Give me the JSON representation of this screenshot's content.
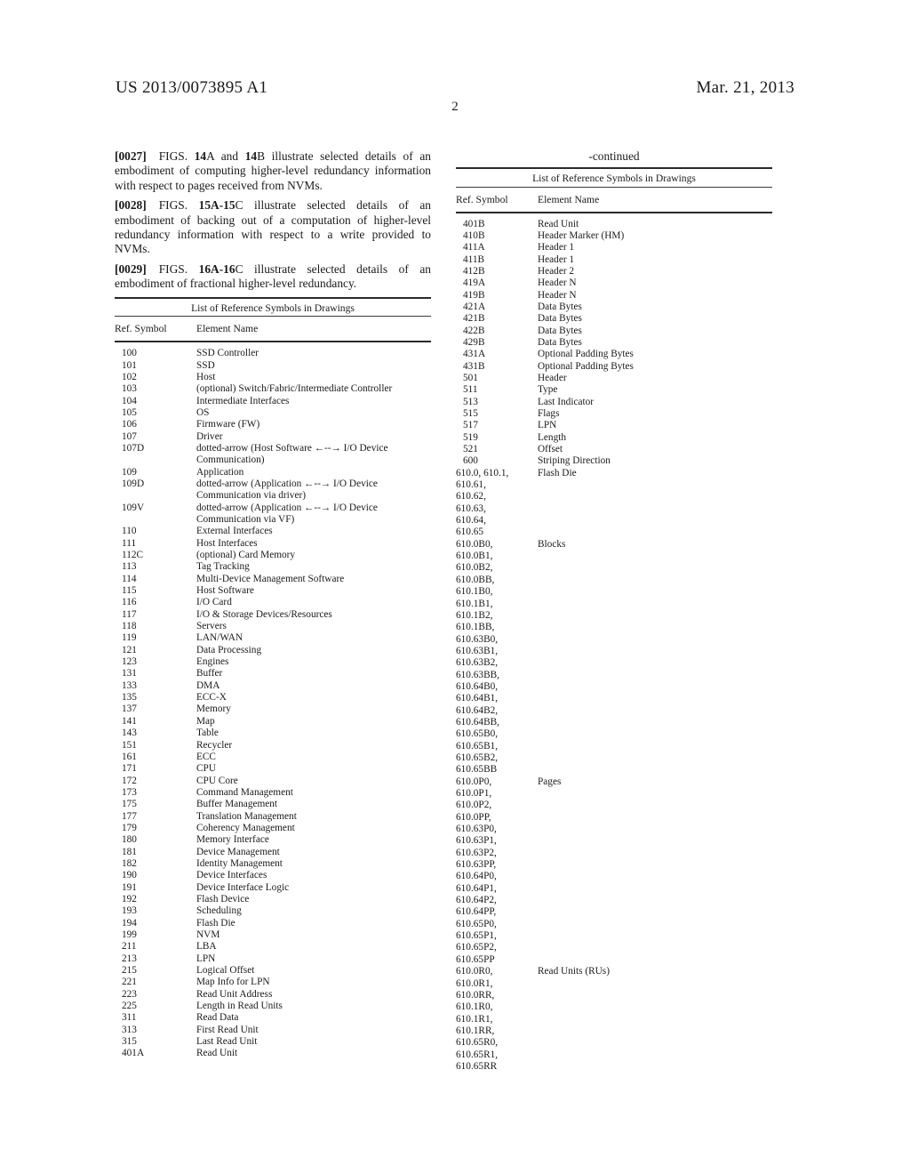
{
  "header": {
    "publication_number": "US 2013/0073895 A1",
    "date": "Mar. 21, 2013",
    "page_number": "2"
  },
  "paragraphs": [
    {
      "number": "[0027]",
      "text": "FIGS. 14A and 14B illustrate selected details of an embodiment of computing higher-level redundancy information with respect to pages received from NVMs."
    },
    {
      "number": "[0028]",
      "text": "FIGS. 15A-15C illustrate selected details of an embodiment of backing out of a computation of higher-level redundancy information with respect to a write provided to NVMs."
    },
    {
      "number": "[0029]",
      "text": "FIGS. 16A-16C illustrate selected details of an embodiment of fractional higher-level redundancy."
    }
  ],
  "left_table": {
    "caption": "List of Reference Symbols in Drawings",
    "columns": [
      "Ref. Symbol",
      "Element Name"
    ],
    "rows": [
      {
        "symbol": "100",
        "name": "SSD Controller"
      },
      {
        "symbol": "101",
        "name": "SSD"
      },
      {
        "symbol": "102",
        "name": "Host"
      },
      {
        "symbol": "103",
        "name": "(optional) Switch/Fabric/Intermediate Controller"
      },
      {
        "symbol": "104",
        "name": "Intermediate Interfaces"
      },
      {
        "symbol": "105",
        "name": "OS"
      },
      {
        "symbol": "106",
        "name": "Firmware (FW)"
      },
      {
        "symbol": "107",
        "name": "Driver"
      },
      {
        "symbol": "107D",
        "name": "dotted-arrow (Host Software ←--→ I/O Device"
      },
      {
        "symbol": "",
        "name": "Communication)"
      },
      {
        "symbol": "109",
        "name": "Application"
      },
      {
        "symbol": "109D",
        "name": "dotted-arrow (Application ←--→ I/O Device"
      },
      {
        "symbol": "",
        "name": "Communication via driver)"
      },
      {
        "symbol": "109V",
        "name": "dotted-arrow (Application ←--→ I/O Device"
      },
      {
        "symbol": "",
        "name": "Communication via VF)"
      },
      {
        "symbol": "110",
        "name": "External Interfaces"
      },
      {
        "symbol": "111",
        "name": "Host Interfaces"
      },
      {
        "symbol": "112C",
        "name": "(optional) Card Memory"
      },
      {
        "symbol": "113",
        "name": "Tag Tracking"
      },
      {
        "symbol": "114",
        "name": "Multi-Device Management Software"
      },
      {
        "symbol": "115",
        "name": "Host Software"
      },
      {
        "symbol": "116",
        "name": "I/O Card"
      },
      {
        "symbol": "117",
        "name": "I/O & Storage Devices/Resources"
      },
      {
        "symbol": "118",
        "name": "Servers"
      },
      {
        "symbol": "119",
        "name": "LAN/WAN"
      },
      {
        "symbol": "121",
        "name": "Data Processing"
      },
      {
        "symbol": "123",
        "name": "Engines"
      },
      {
        "symbol": "131",
        "name": "Buffer"
      },
      {
        "symbol": "133",
        "name": "DMA"
      },
      {
        "symbol": "135",
        "name": "ECC-X"
      },
      {
        "symbol": "137",
        "name": "Memory"
      },
      {
        "symbol": "141",
        "name": "Map"
      },
      {
        "symbol": "143",
        "name": "Table"
      },
      {
        "symbol": "151",
        "name": "Recycler"
      },
      {
        "symbol": "161",
        "name": "ECC"
      },
      {
        "symbol": "171",
        "name": "CPU"
      },
      {
        "symbol": "172",
        "name": "CPU Core"
      },
      {
        "symbol": "173",
        "name": "Command Management"
      },
      {
        "symbol": "175",
        "name": "Buffer Management"
      },
      {
        "symbol": "177",
        "name": "Translation Management"
      },
      {
        "symbol": "179",
        "name": "Coherency Management"
      },
      {
        "symbol": "180",
        "name": "Memory Interface"
      },
      {
        "symbol": "181",
        "name": "Device Management"
      },
      {
        "symbol": "182",
        "name": "Identity Management"
      },
      {
        "symbol": "190",
        "name": "Device Interfaces"
      },
      {
        "symbol": "191",
        "name": "Device Interface Logic"
      },
      {
        "symbol": "192",
        "name": "Flash Device"
      },
      {
        "symbol": "193",
        "name": "Scheduling"
      },
      {
        "symbol": "194",
        "name": "Flash Die"
      },
      {
        "symbol": "199",
        "name": "NVM"
      },
      {
        "symbol": "211",
        "name": "LBA"
      },
      {
        "symbol": "213",
        "name": "LPN"
      },
      {
        "symbol": "215",
        "name": "Logical Offset"
      },
      {
        "symbol": "221",
        "name": "Map Info for LPN"
      },
      {
        "symbol": "223",
        "name": "Read Unit Address"
      },
      {
        "symbol": "225",
        "name": "Length in Read Units"
      },
      {
        "symbol": "311",
        "name": "Read Data"
      },
      {
        "symbol": "313",
        "name": "First Read Unit"
      },
      {
        "symbol": "315",
        "name": "Last Read Unit"
      },
      {
        "symbol": "401A",
        "name": "Read Unit"
      }
    ]
  },
  "right_table": {
    "continued_label": "-continued",
    "caption": "List of Reference Symbols in Drawings",
    "columns": [
      "Ref. Symbol",
      "Element Name"
    ],
    "rows": [
      {
        "symbol": "401B",
        "name": "Read Unit"
      },
      {
        "symbol": "410B",
        "name": "Header Marker (HM)"
      },
      {
        "symbol": "411A",
        "name": "Header 1"
      },
      {
        "symbol": "411B",
        "name": "Header 1"
      },
      {
        "symbol": "412B",
        "name": "Header 2"
      },
      {
        "symbol": "419A",
        "name": "Header N"
      },
      {
        "symbol": "419B",
        "name": "Header N"
      },
      {
        "symbol": "421A",
        "name": "Data Bytes"
      },
      {
        "symbol": "421B",
        "name": "Data Bytes"
      },
      {
        "symbol": "422B",
        "name": "Data Bytes"
      },
      {
        "symbol": "429B",
        "name": "Data Bytes"
      },
      {
        "symbol": "431A",
        "name": "Optional Padding Bytes"
      },
      {
        "symbol": "431B",
        "name": "Optional Padding Bytes"
      },
      {
        "symbol": "501",
        "name": "Header"
      },
      {
        "symbol": "511",
        "name": "Type"
      },
      {
        "symbol": "513",
        "name": "Last Indicator"
      },
      {
        "symbol": "515",
        "name": "Flags"
      },
      {
        "symbol": "517",
        "name": "LPN"
      },
      {
        "symbol": "519",
        "name": "Length"
      },
      {
        "symbol": "521",
        "name": "Offset"
      },
      {
        "symbol": "600",
        "name": "Striping Direction"
      },
      {
        "symbol": "610.0, 610.1,",
        "name": "Flash Die",
        "wide": true
      },
      {
        "symbol": "610.61,",
        "name": "",
        "wide": true
      },
      {
        "symbol": "610.62,",
        "name": "",
        "wide": true
      },
      {
        "symbol": "610.63,",
        "name": "",
        "wide": true
      },
      {
        "symbol": "610.64,",
        "name": "",
        "wide": true
      },
      {
        "symbol": "610.65",
        "name": "",
        "wide": true
      },
      {
        "symbol": "610.0B0,",
        "name": "Blocks",
        "wide": true
      },
      {
        "symbol": "610.0B1,",
        "name": "",
        "wide": true
      },
      {
        "symbol": "610.0B2,",
        "name": "",
        "wide": true
      },
      {
        "symbol": "610.0BB,",
        "name": "",
        "wide": true
      },
      {
        "symbol": "610.1B0,",
        "name": "",
        "wide": true
      },
      {
        "symbol": "610.1B1,",
        "name": "",
        "wide": true
      },
      {
        "symbol": "610.1B2,",
        "name": "",
        "wide": true
      },
      {
        "symbol": "610.1BB,",
        "name": "",
        "wide": true
      },
      {
        "symbol": "610.63B0,",
        "name": "",
        "wide": true
      },
      {
        "symbol": "610.63B1,",
        "name": "",
        "wide": true
      },
      {
        "symbol": "610.63B2,",
        "name": "",
        "wide": true
      },
      {
        "symbol": "610.63BB,",
        "name": "",
        "wide": true
      },
      {
        "symbol": "610.64B0,",
        "name": "",
        "wide": true
      },
      {
        "symbol": "610.64B1,",
        "name": "",
        "wide": true
      },
      {
        "symbol": "610.64B2,",
        "name": "",
        "wide": true
      },
      {
        "symbol": "610.64BB,",
        "name": "",
        "wide": true
      },
      {
        "symbol": "610.65B0,",
        "name": "",
        "wide": true
      },
      {
        "symbol": "610.65B1,",
        "name": "",
        "wide": true
      },
      {
        "symbol": "610.65B2,",
        "name": "",
        "wide": true
      },
      {
        "symbol": "610.65BB",
        "name": "",
        "wide": true
      },
      {
        "symbol": "610.0P0,",
        "name": "Pages",
        "wide": true
      },
      {
        "symbol": "610.0P1,",
        "name": "",
        "wide": true
      },
      {
        "symbol": "610.0P2,",
        "name": "",
        "wide": true
      },
      {
        "symbol": "610.0PP,",
        "name": "",
        "wide": true
      },
      {
        "symbol": "610.63P0,",
        "name": "",
        "wide": true
      },
      {
        "symbol": "610.63P1,",
        "name": "",
        "wide": true
      },
      {
        "symbol": "610.63P2,",
        "name": "",
        "wide": true
      },
      {
        "symbol": "610.63PP,",
        "name": "",
        "wide": true
      },
      {
        "symbol": "610.64P0,",
        "name": "",
        "wide": true
      },
      {
        "symbol": "610.64P1,",
        "name": "",
        "wide": true
      },
      {
        "symbol": "610.64P2,",
        "name": "",
        "wide": true
      },
      {
        "symbol": "610.64PP,",
        "name": "",
        "wide": true
      },
      {
        "symbol": "610.65P0,",
        "name": "",
        "wide": true
      },
      {
        "symbol": "610.65P1,",
        "name": "",
        "wide": true
      },
      {
        "symbol": "610.65P2,",
        "name": "",
        "wide": true
      },
      {
        "symbol": "610.65PP",
        "name": "",
        "wide": true
      },
      {
        "symbol": "610.0R0,",
        "name": "Read Units (RUs)",
        "wide": true
      },
      {
        "symbol": "610.0R1,",
        "name": "",
        "wide": true
      },
      {
        "symbol": "610.0RR,",
        "name": "",
        "wide": true
      },
      {
        "symbol": "610.1R0,",
        "name": "",
        "wide": true
      },
      {
        "symbol": "610.1R1,",
        "name": "",
        "wide": true
      },
      {
        "symbol": "610.1RR,",
        "name": "",
        "wide": true
      },
      {
        "symbol": "610.65R0,",
        "name": "",
        "wide": true
      },
      {
        "symbol": "610.65R1,",
        "name": "",
        "wide": true
      },
      {
        "symbol": "610.65RR",
        "name": "",
        "wide": true
      }
    ]
  }
}
